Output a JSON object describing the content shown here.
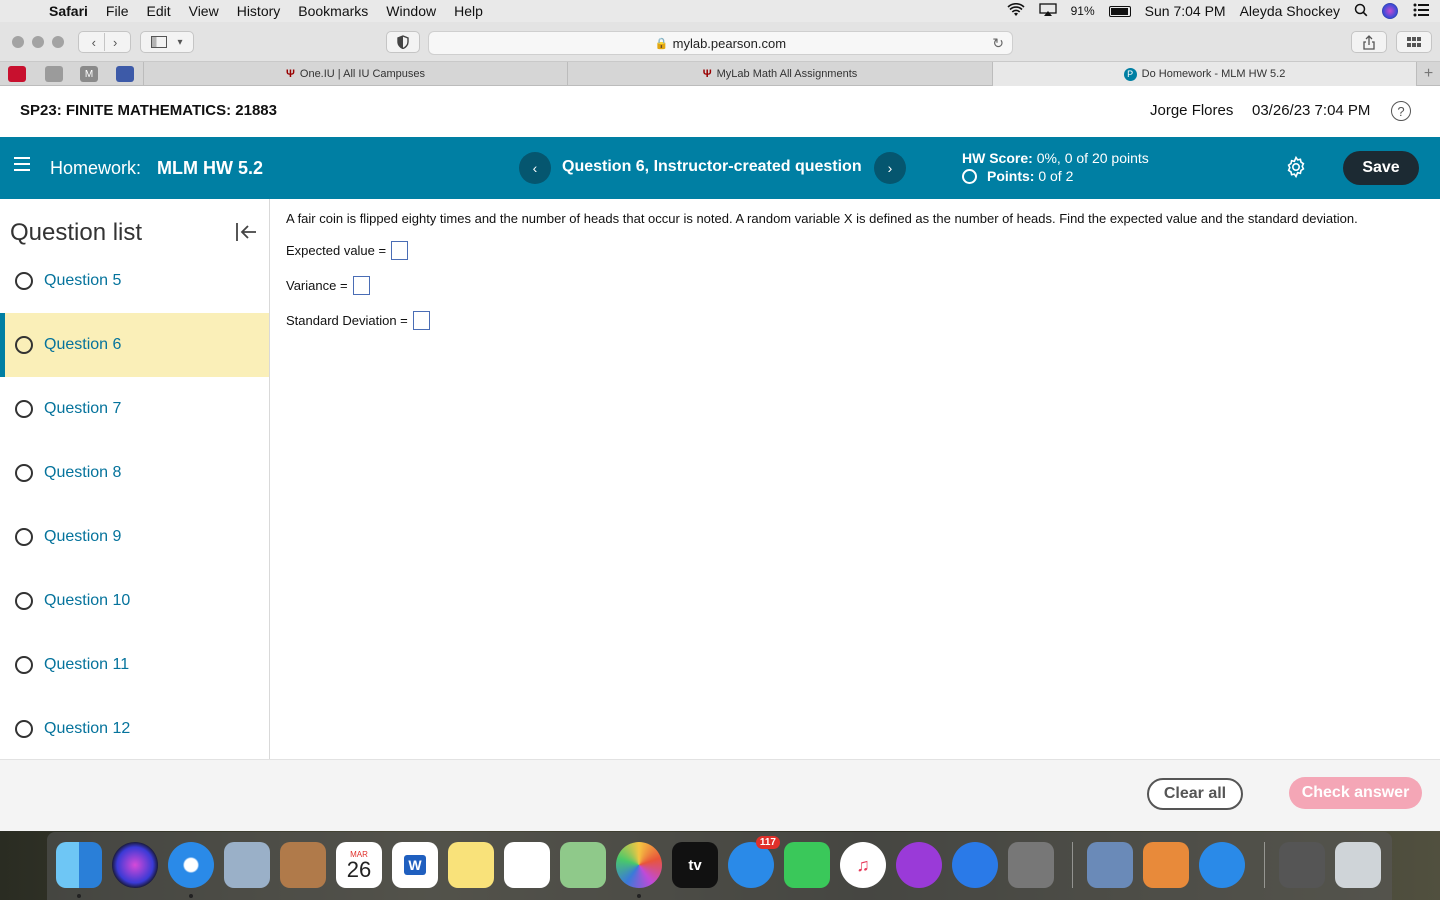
{
  "menubar": {
    "apple": "",
    "items": [
      "Safari",
      "File",
      "Edit",
      "View",
      "History",
      "Bookmarks",
      "Window",
      "Help"
    ],
    "battery_pct": "91%",
    "clock": "Sun 7:04 PM",
    "user": "Aleyda Shockey"
  },
  "browser": {
    "url": "mylab.pearson.com",
    "tabs": [
      {
        "label": "One.IU | All IU Campuses",
        "icon": "iu-icon"
      },
      {
        "label": "MyLab Math All Assignments",
        "icon": "iu-icon"
      },
      {
        "label": "Do Homework - MLM HW 5.2",
        "icon": "pearson-icon"
      }
    ],
    "bookmark_m": "M"
  },
  "header": {
    "course_title": "SP23: FINITE MATHEMATICS: 21883",
    "student_name": "Jorge Flores",
    "datetime": "03/26/23 7:04 PM",
    "help": "?"
  },
  "hwbar": {
    "homework_label": "Homework:",
    "homework_name": "MLM HW 5.2",
    "prev": "‹",
    "next": "›",
    "question_title": "Question 6, Instructor-created question",
    "hw_score_label": "HW Score:",
    "hw_score_value": "0%, 0 of 20 points",
    "points_label": "Points:",
    "points_value": "0 of 2",
    "save_label": "Save"
  },
  "sidebar": {
    "title": "Question list",
    "questions": [
      {
        "label": "Question 5",
        "active": false
      },
      {
        "label": "Question 6",
        "active": true
      },
      {
        "label": "Question 7",
        "active": false
      },
      {
        "label": "Question 8",
        "active": false
      },
      {
        "label": "Question 9",
        "active": false
      },
      {
        "label": "Question 10",
        "active": false
      },
      {
        "label": "Question 11",
        "active": false
      },
      {
        "label": "Question 12",
        "active": false
      }
    ]
  },
  "question": {
    "prompt": "A fair coin is flipped eighty times and the number of heads that occur is noted. A random variable X is defined as the number of heads. Find the expected value and the standard deviation.",
    "fields": [
      {
        "label": "Expected value =",
        "value": ""
      },
      {
        "label": "Variance =",
        "value": ""
      },
      {
        "label": "Standard Deviation =",
        "value": ""
      }
    ]
  },
  "footer": {
    "clear_label": "Clear all",
    "check_label": "Check answer"
  },
  "dock": {
    "calendar_month": "MAR",
    "calendar_day": "26",
    "word_letter": "W",
    "tv_label": "tv",
    "messages_badge": "117"
  },
  "colors": {
    "brand_bar": "#007fa3",
    "active_question_bg": "#faefb8",
    "link": "#05739c",
    "check_answer_disabled": "#f4a6b6"
  }
}
